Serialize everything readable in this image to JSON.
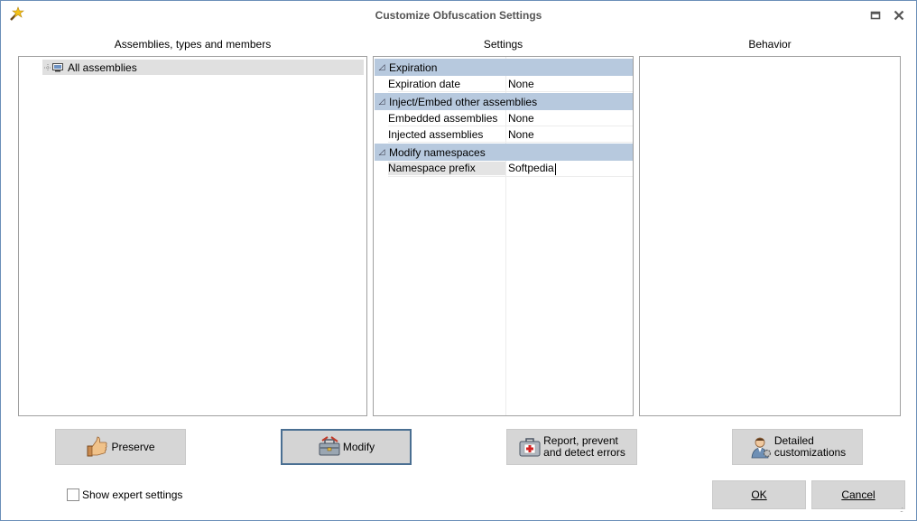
{
  "window": {
    "title": "Customize Obfuscation Settings"
  },
  "columns": {
    "assemblies_title": "Assemblies, types and members",
    "settings_title": "Settings",
    "behavior_title": "Behavior"
  },
  "tree": {
    "root_label": "All assemblies"
  },
  "settings": {
    "categories": [
      {
        "label": "Expiration",
        "properties": [
          {
            "name": "Expiration date",
            "value": "None"
          }
        ]
      },
      {
        "label": "Inject/Embed other assemblies",
        "properties": [
          {
            "name": "Embedded assemblies",
            "value": "None"
          },
          {
            "name": "Injected assemblies",
            "value": "None"
          }
        ]
      },
      {
        "label": "Modify namespaces",
        "properties": [
          {
            "name": "Namespace prefix",
            "value": "Softpedia"
          }
        ]
      }
    ]
  },
  "actions": {
    "preserve": "Preserve",
    "modify": "Modify",
    "report": "Report, prevent\nand detect errors",
    "detailed": "Detailed\ncustomizations"
  },
  "footer": {
    "expert_label": "Show expert settings",
    "ok": "OK",
    "cancel": "Cancel"
  },
  "colors": {
    "category_band": "#b7c9de",
    "active_border": "#4a6f92",
    "button_face": "#d6d6d6"
  },
  "icons": {
    "app": "wand-icon",
    "preserve": "thumbs-up-icon",
    "modify": "toolbox-icon",
    "report": "first-aid-kit-icon",
    "detailed": "user-gear-icon"
  }
}
